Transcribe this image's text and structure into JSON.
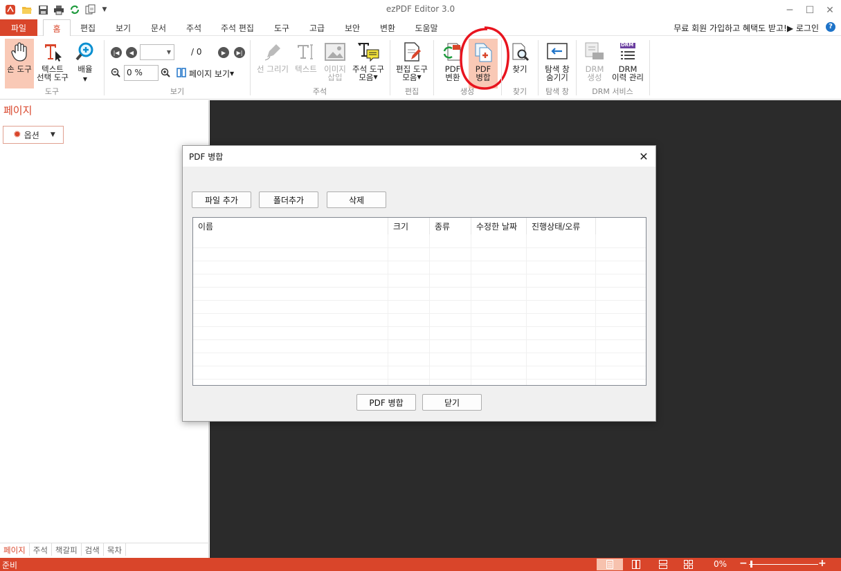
{
  "app": {
    "title": "ezPDF Editor 3.0"
  },
  "quick_access": [
    "adobe-logo-icon",
    "open-folder-icon",
    "save-icon",
    "print-icon",
    "refresh-icon",
    "copy-icon",
    "dropdown-icon"
  ],
  "menu": {
    "tabs": [
      "파일",
      "홈",
      "편집",
      "보기",
      "문서",
      "주석",
      "주석 편집",
      "도구",
      "고급",
      "보안",
      "변환",
      "도움말"
    ],
    "promo": "무료 회원 가입하고 혜택도 받고!▶ 로그인",
    "help": "?"
  },
  "ribbon": {
    "hand_tool": "손 도구",
    "text_select_1": "텍스트",
    "text_select_2": "선택 도구",
    "zoom_mag": "배율",
    "group_tools": "도구",
    "page_total": "/ 0",
    "zoom_value": "0 %",
    "page_view": "페이지 보기",
    "group_view": "보기",
    "line_draw": "선 그리기",
    "text": "텍스트",
    "image_insert_1": "이미지",
    "image_insert_2": "삽입",
    "annot_tools_1": "주석 도구",
    "annot_tools_2": "모음",
    "group_annot": "주석",
    "edit_tools_1": "편집 도구",
    "edit_tools_2": "모음",
    "group_edit": "편집",
    "pdf_convert_1": "PDF",
    "pdf_convert_2": "변환",
    "pdf_merge_1": "PDF",
    "pdf_merge_2": "병합",
    "group_create": "생성",
    "find": "찾기",
    "group_find": "찾기",
    "nav_hide_1": "탐색 창",
    "nav_hide_2": "숨기기",
    "group_nav": "탐색 창",
    "drm_create_1": "DRM",
    "drm_create_2": "생성",
    "drm_history_1": "DRM",
    "drm_history_2": "이력 관리",
    "group_drm": "DRM 서비스",
    "drm_badge": "DRM"
  },
  "left_panel": {
    "title": "페이지",
    "options": "옵션",
    "tabs": [
      "페이지",
      "주석",
      "책갈피",
      "검색",
      "목차"
    ]
  },
  "status": {
    "text": "준비",
    "zoom": "0%"
  },
  "dialog": {
    "title": "PDF 병합",
    "add_file": "파일 추가",
    "add_folder": "폴더추가",
    "delete": "삭제",
    "columns": [
      "이름",
      "크기",
      "종류",
      "수정한 날짜",
      "진행상태/오류"
    ],
    "merge_button": "PDF 병합",
    "close_button": "닫기"
  },
  "colors": {
    "accent": "#d9452a",
    "highlight": "#f9c9b6",
    "doc_bg": "#2b2b2b",
    "annotation_circle": "#e8141e"
  }
}
